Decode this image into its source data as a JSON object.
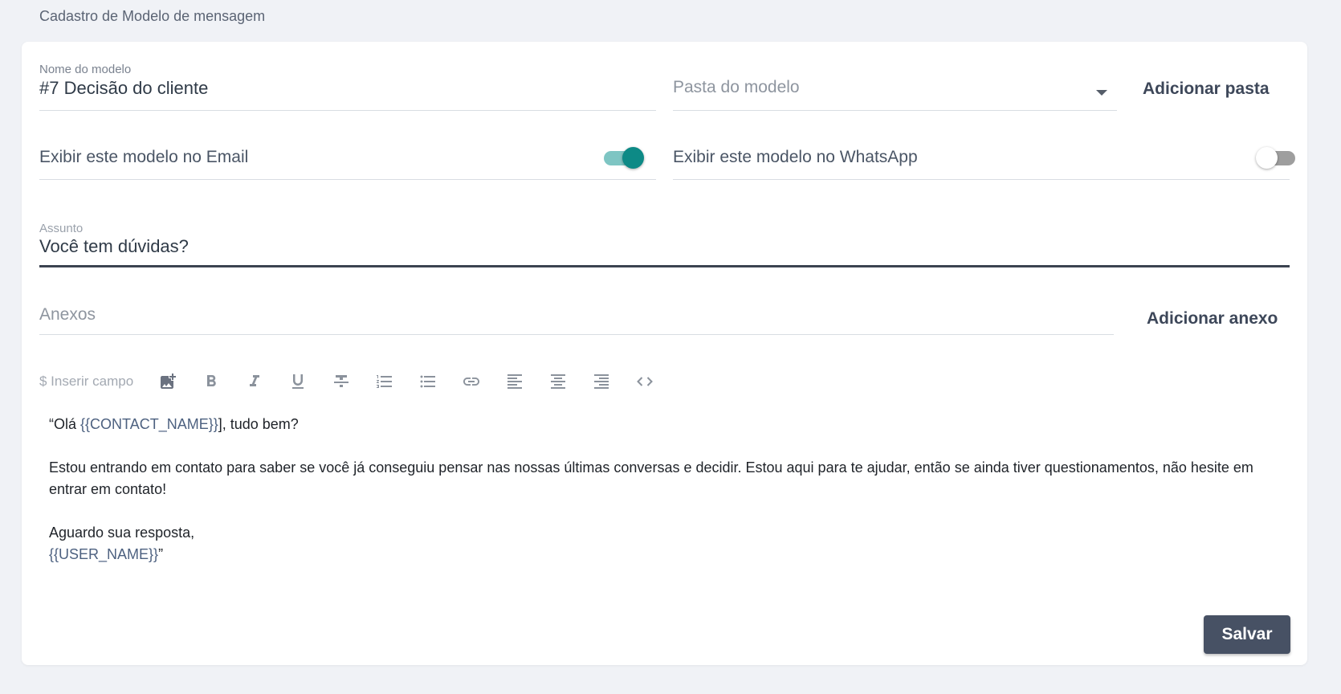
{
  "page": {
    "title": "Cadastro de Modelo de mensagem"
  },
  "form": {
    "name_label": "Nome do modelo",
    "name_value": "#7 Decisão do cliente",
    "folder_placeholder": "Pasta do modelo",
    "add_folder_label": "Adicionar pasta",
    "email_toggle_label": "Exibir este modelo no Email",
    "email_toggle_on": true,
    "whatsapp_toggle_label": "Exibir este modelo no WhatsApp",
    "whatsapp_toggle_on": false,
    "subject_label": "Assunto",
    "subject_value": "Você tem dúvidas?",
    "attachments_placeholder": "Anexos",
    "add_attachment_label": "Adicionar anexo"
  },
  "toolbar": {
    "insert_field_label": "$ Inserir campo",
    "icons": [
      "add-image-icon",
      "bold-icon",
      "italic-icon",
      "underline-icon",
      "strikethrough-icon",
      "ordered-list-icon",
      "bullet-list-icon",
      "link-icon",
      "align-left-icon",
      "align-center-icon",
      "align-right-icon",
      "code-icon"
    ]
  },
  "editor": {
    "line1_prefix": "“Olá ",
    "line1_var": "{{CONTACT_NAME}}",
    "line1_suffix": "], tudo bem?",
    "paragraph2": "Estou entrando em contato para saber se você já conseguiu pensar nas nossas últimas conversas e decidir. Estou aqui para te ajudar, então se ainda tiver questionamentos, não hesite em entrar em contato!",
    "closing": "Aguardo sua resposta,",
    "signature_var": "{{USER_NAME}}",
    "signature_suffix": "”"
  },
  "actions": {
    "save_label": "Salvar"
  },
  "colors": {
    "accent": "#0d8a86",
    "save_button": "#475164"
  }
}
